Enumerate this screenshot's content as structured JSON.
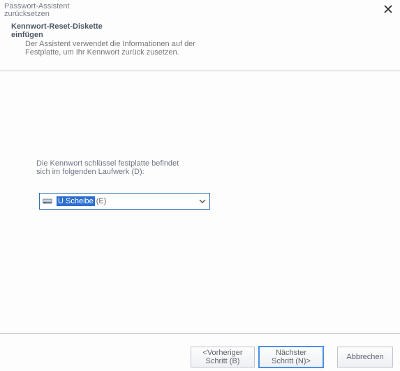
{
  "titlebar": {
    "title": "Passwort-Assistent zurücksetzen"
  },
  "header": {
    "title": "Kennwort-Reset-Diskette einfügen",
    "subtitle": "Der Assistent verwendet die Informationen auf der Festplatte, um Ihr Kennwort zurück zusetzen."
  },
  "body": {
    "prompt": "Die Kennwort schlüssel festplatte befindet sich im folgenden Laufwerk (D):",
    "drive_select": {
      "highlight": "U Scheibe",
      "suffix": " (E)"
    }
  },
  "footer": {
    "back": "<Vorheriger Schritt (B)",
    "next": "Nächster Schritt (N)>",
    "cancel": "Abbrechen"
  }
}
